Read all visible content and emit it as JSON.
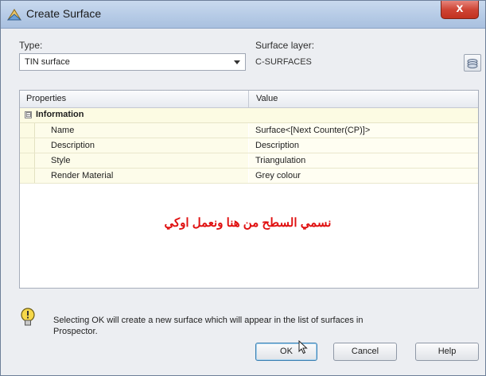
{
  "window": {
    "title": "Create Surface",
    "close_glyph": "x"
  },
  "type": {
    "label": "Type:",
    "value": "TIN surface"
  },
  "surface_layer": {
    "label": "Surface layer:",
    "value": "C-SURFACES"
  },
  "grid": {
    "col_properties": "Properties",
    "col_value": "Value",
    "category": {
      "toggle": "⊟",
      "label": "Information"
    },
    "rows": [
      {
        "name": "Name",
        "value": "Surface<[Next Counter(CP)]>"
      },
      {
        "name": "Description",
        "value": "Description"
      },
      {
        "name": "Style",
        "value": "Triangulation"
      },
      {
        "name": "Render Material",
        "value": "Grey colour"
      }
    ]
  },
  "overlay_text": "نسمي السطح من هنا ونعمل اوكي",
  "info": {
    "line1": "Selecting OK will create a new surface which will appear in the list of surfaces in",
    "line2": "Prospector."
  },
  "buttons": {
    "ok": "OK",
    "cancel": "Cancel",
    "help": "Help"
  },
  "colors": {
    "titlebar": "#b6cbe6",
    "close": "#c2311f",
    "overlay": "#e01010"
  }
}
